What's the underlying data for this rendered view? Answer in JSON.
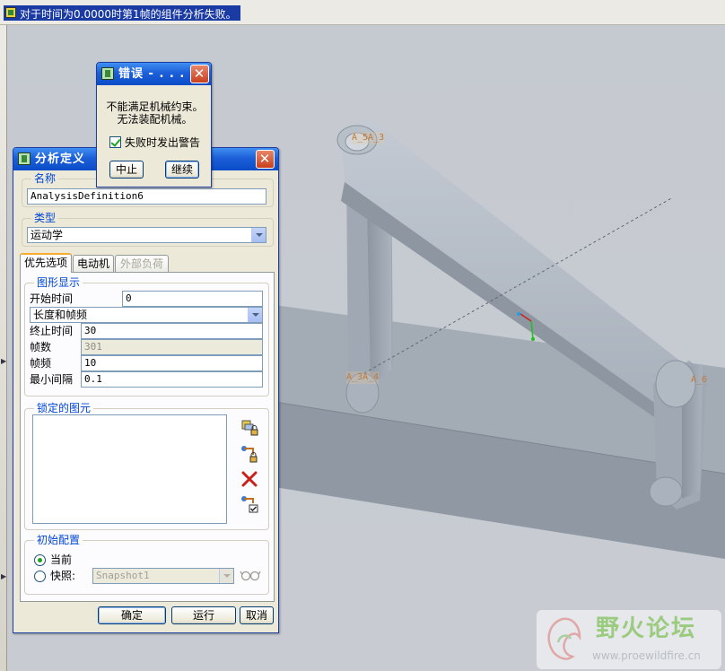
{
  "status_message": "对于时间为0.0000时第1帧的组件分析失败。",
  "error_dialog": {
    "title": "错误 - . . .",
    "message_line1": "不能满足机械约束。",
    "message_line2": "无法装配机械。",
    "warn_checkbox_label": "失败时发出警告",
    "warn_checked": true,
    "abort_label": "中止",
    "continue_label": "继续"
  },
  "analysis_dialog": {
    "title": "分析定义",
    "name_group": "名称",
    "name_value": "AnalysisDefinition6",
    "type_group": "类型",
    "type_value": "运动学",
    "tabs": [
      {
        "label": "优先选项",
        "active": true,
        "enabled": true
      },
      {
        "label": "电动机",
        "active": false,
        "enabled": true
      },
      {
        "label": "外部负荷",
        "active": false,
        "enabled": false
      }
    ],
    "graphics_group": "图形显示",
    "start_time_label": "开始时间",
    "start_time_value": "0",
    "mode_value": "长度和帧频",
    "end_time_label": "终止时间",
    "end_time_value": "30",
    "frames_label": "帧数",
    "frames_value": "301",
    "frame_rate_label": "帧频",
    "frame_rate_value": "10",
    "min_interval_label": "最小间隔",
    "min_interval_value": "0.1",
    "locked_group": "锁定的图元",
    "initial_group": "初始配置",
    "current_label": "当前",
    "snapshot_label": "快照:",
    "snapshot_value": "Snapshot1",
    "ok_label": "确定",
    "run_label": "运行",
    "cancel_label": "取消"
  },
  "viewport_labels": {
    "joint_top": "A_5A_3",
    "joint_left": "A_3A_4",
    "joint_right": "A_6"
  },
  "watermark": {
    "brand": "野火论坛",
    "url": "www.proewildfire.cn"
  },
  "colors": {
    "title_bar": "#0a4cc8",
    "dialog_face": "#ece9d8",
    "model_grey": "#9aa3ae",
    "label_orange": "#c0793a"
  }
}
